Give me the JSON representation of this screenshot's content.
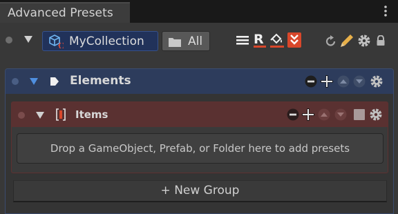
{
  "window": {
    "tab_title": "Advanced Presets",
    "menu_icon": "kebab-menu-icon"
  },
  "header": {
    "collection_field": {
      "icon": "prefab-cube-icon",
      "label": "MyCollection"
    },
    "filter_button": {
      "icon": "folder-icon",
      "label": "All"
    },
    "toolbar_icons": [
      "list-icon",
      "rename-icon",
      "fill-icon",
      "collapse-all-icon",
      "refresh-icon",
      "pencil-icon",
      "gear-icon",
      "lock-icon"
    ]
  },
  "elements_group": {
    "title": "Elements",
    "controls": [
      "minus-icon",
      "plus-icon",
      "move-up-icon",
      "move-down-icon",
      "gear-icon"
    ],
    "header_color": "#2d3c5c"
  },
  "items_group": {
    "title": "Items",
    "controls": [
      "minus-icon",
      "plus-icon",
      "move-up-icon",
      "move-down-icon",
      "checkbox-icon",
      "gear-icon"
    ],
    "header_color": "#5a3131",
    "dropzone_text": "Drop a GameObject, Prefab, or Folder here to add presets"
  },
  "new_group_button": "+ New Group",
  "colors": {
    "background": "#383838",
    "collection_field_bg": "#21325a",
    "accent_red": "#d9472b"
  }
}
